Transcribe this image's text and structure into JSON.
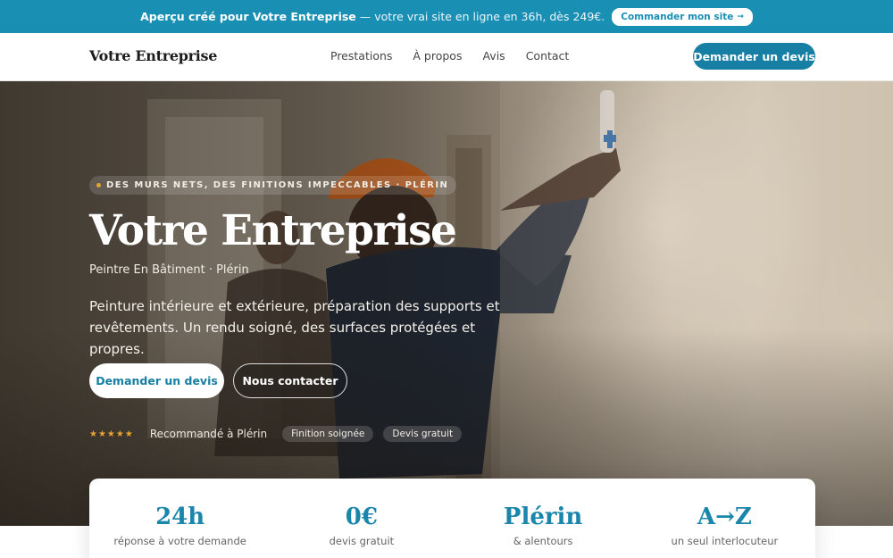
{
  "promo": {
    "highlight": "Aperçu créé pour Votre Entreprise",
    "text": "— votre vrai site en ligne en 36h, dès 249€.",
    "button_label": "Commander mon site",
    "button_arrow": "→"
  },
  "header": {
    "brand": "Votre Entreprise",
    "nav": [
      "Prestations",
      "À propos",
      "Avis",
      "Contact"
    ],
    "cta_label": "Demander un devis"
  },
  "hero": {
    "eyebrow": "DES MURS NETS, DES FINITIONS IMPECCABLES · PLÉRIN",
    "title": "Votre Entreprise",
    "subtitle": "Peintre En Bâtiment · Plérin",
    "description": "Peinture intérieure et extérieure, préparation des supports et revêtements. Un rendu soigné, des surfaces protégées et propres.",
    "primary_button": "Demander un devis",
    "secondary_button": "Nous contacter",
    "rating_stars": "★★★★★",
    "rating_label": "Recommandé à Plérin",
    "chips": [
      "Finition soignée",
      "Devis gratuit"
    ]
  },
  "stats": [
    {
      "value": "24h",
      "label": "réponse à votre demande"
    },
    {
      "value": "0€",
      "label": "devis gratuit"
    },
    {
      "value": "Plérin",
      "label": "& alentours"
    },
    {
      "value": "A→Z",
      "label": "un seul interlocuteur"
    }
  ],
  "colors": {
    "accent": "#1a8fb4",
    "button": "#167fa3",
    "star": "#e7a431"
  }
}
